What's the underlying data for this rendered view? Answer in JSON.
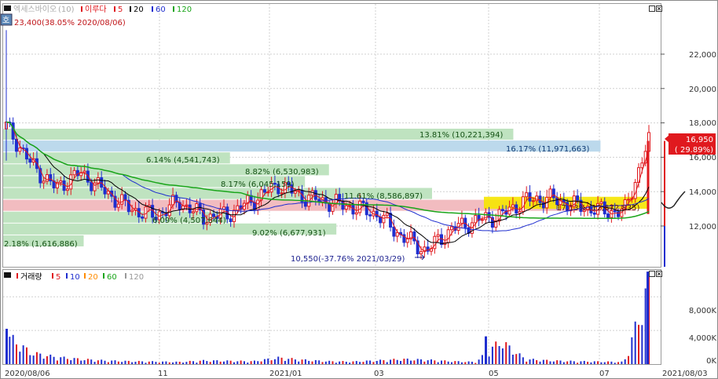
{
  "price_panel": {
    "legend": {
      "name": "엑세스바이오",
      "period_label": "(10)",
      "ma_prefix": "이루다",
      "ma": [
        {
          "label": "5",
          "color": "#e0191e"
        },
        {
          "label": "20",
          "color": "#000000"
        },
        {
          "label": "60",
          "color": "#1f2ecf"
        },
        {
          "label": "120",
          "color": "#19a519"
        }
      ]
    },
    "high_note": "23,400(38.05% 2020/08/06)",
    "low_note": "10,550(-37.76% 2021/03/29)",
    "current_price": "16,950",
    "current_change": "( 29.89%)",
    "y_ticks": [
      "22,000",
      "20,000",
      "18,000",
      "16,000",
      "14,000",
      "12,000"
    ]
  },
  "volume_panel": {
    "legend": {
      "title": "거래량",
      "ma": [
        {
          "label": "5",
          "color": "#e0191e"
        },
        {
          "label": "10",
          "color": "#1f2ecf"
        },
        {
          "label": "20",
          "color": "#ff8c00"
        },
        {
          "label": "60",
          "color": "#19a519"
        },
        {
          "label": "120",
          "color": "#999999"
        }
      ]
    },
    "y_ticks": [
      "8,000K",
      "4,000K",
      "0K"
    ]
  },
  "x_ticks": [
    "2020/08/06",
    "11",
    "2021/01",
    "03",
    "05",
    "07"
  ],
  "x_end_label": "2021/08/03",
  "volume_profile": [
    {
      "label": "13.81% (10,221,394)",
      "pct": 13.81,
      "color": "#bfe3c0"
    },
    {
      "label": "16.17% (11,971,663)",
      "pct": 16.17,
      "color": "#bcd9ec"
    },
    {
      "label": "6.14% (4,541,743)",
      "pct": 6.14,
      "color": "#bfe3c0"
    },
    {
      "label": "8.82% (6,530,983)",
      "pct": 8.82,
      "color": "#bfe3c0"
    },
    {
      "label": "8.17% (6,045,159)",
      "pct": 8.17,
      "color": "#bfe3c0"
    },
    {
      "label": "11.61% (8,586,897)",
      "pct": 11.61,
      "color": "#bfe3c0"
    },
    {
      "label": "17.13% (12,672,835)",
      "pct": 17.13,
      "color": "#f2bcc0"
    },
    {
      "label": "6.09% (4,507,644)",
      "pct": 6.09,
      "color": "#bfe3c0"
    },
    {
      "label": "9.02% (6,677,931)",
      "pct": 9.02,
      "color": "#bfe3c0"
    },
    {
      "label": "2.18% (1,616,886)",
      "pct": 2.18,
      "color": "#bfe3c0"
    }
  ],
  "chart_data": {
    "type": "candlestick",
    "ylim": [
      10000,
      23400
    ],
    "volume_ylim": [
      0,
      11200
    ],
    "dates": [
      "2020/08/06",
      "2020/08/20",
      "2020/09/03",
      "2020/09/17",
      "2020/10/01",
      "2020/10/15",
      "2020/10/29",
      "2020/11/12",
      "2020/11/26",
      "2020/12/10",
      "2020/12/24",
      "2021/01/07",
      "2021/01/21",
      "2021/02/04",
      "2021/02/18",
      "2021/03/04",
      "2021/03/18",
      "2021/03/29",
      "2021/04/12",
      "2021/04/26",
      "2021/05/10",
      "2021/05/24",
      "2021/06/07",
      "2021/06/21",
      "2021/07/05",
      "2021/07/19",
      "2021/08/03"
    ],
    "close": [
      17800,
      15600,
      14200,
      15100,
      14000,
      13000,
      12600,
      13400,
      12500,
      12700,
      13500,
      14400,
      13700,
      13400,
      13100,
      12700,
      11400,
      10550,
      11800,
      12300,
      12600,
      13500,
      13600,
      13200,
      12900,
      12800,
      16950
    ],
    "volume": [
      4200,
      1600,
      1000,
      700,
      500,
      400,
      350,
      300,
      500,
      450,
      400,
      900,
      600,
      400,
      350,
      500,
      700,
      600,
      400,
      300,
      3300,
      700,
      500,
      400,
      350,
      300,
      11000
    ]
  }
}
